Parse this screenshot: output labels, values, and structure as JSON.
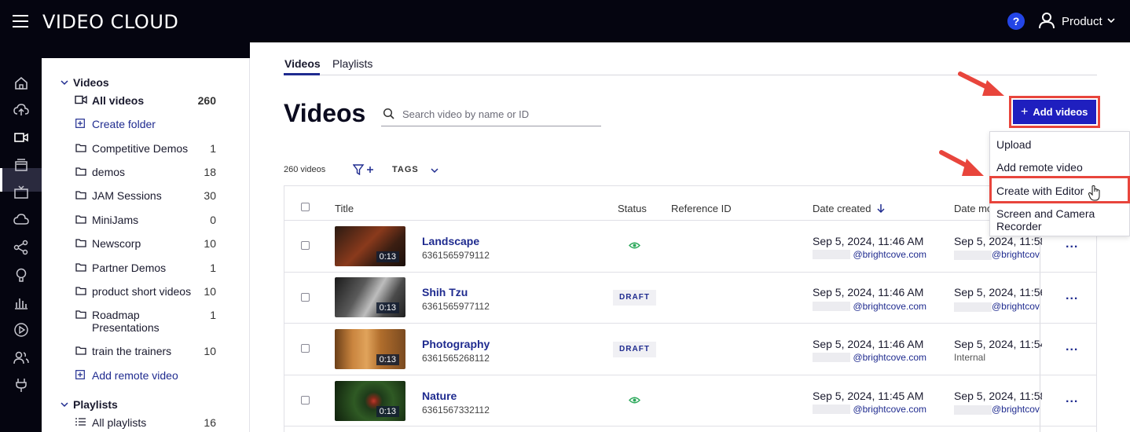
{
  "app": {
    "brand": "VIDEO CLOUD",
    "help_label": "?",
    "account_label": "Product"
  },
  "colors": {
    "accent": "#1f1fbf",
    "link": "#1f2b8f",
    "highlight": "#e8453c",
    "topbar": "#050510"
  },
  "rail": {
    "icons": [
      "home-icon",
      "upload-icon",
      "video-icon",
      "media-icon",
      "tv-icon",
      "cloud-icon",
      "share-icon",
      "lightbulb-icon",
      "analytics-icon",
      "play-icon",
      "users-icon",
      "plug-icon"
    ]
  },
  "sidebar": {
    "videos_section": "Videos",
    "all_videos": {
      "label": "All videos",
      "count": "260"
    },
    "create_folder": "Create folder",
    "folders": [
      {
        "label": "Competitive Demos",
        "count": "1"
      },
      {
        "label": "demos",
        "count": "18"
      },
      {
        "label": "JAM Sessions",
        "count": "30"
      },
      {
        "label": "MiniJams",
        "count": "0"
      },
      {
        "label": "Newscorp",
        "count": "10"
      },
      {
        "label": "Partner Demos",
        "count": "1"
      },
      {
        "label": "product short videos",
        "count": "10"
      },
      {
        "label": "Roadmap\nPresentations",
        "count": "1"
      },
      {
        "label": "train the trainers",
        "count": "10"
      }
    ],
    "add_remote_video": "Add remote video",
    "playlists_section": "Playlists",
    "all_playlists": {
      "label": "All playlists",
      "count": "16"
    }
  },
  "tabs": [
    {
      "label": "Videos"
    },
    {
      "label": "Playlists"
    }
  ],
  "page": {
    "title": "Videos",
    "search_placeholder": "Search video by name or ID",
    "add_videos_label": "Add videos",
    "video_count": "260 videos",
    "tags_label": "TAGS"
  },
  "menu": {
    "items": [
      "Upload",
      "Add remote video",
      "Create with Editor",
      "Screen and Camera\nRecorder"
    ]
  },
  "table": {
    "headers": {
      "title": "Title",
      "status": "Status",
      "reference_id": "Reference ID",
      "date_created": "Date created",
      "date_modified": "Date mo"
    },
    "rows": [
      {
        "title": "Landscape",
        "id": "6361565979112",
        "duration": "0:13",
        "status": "visible",
        "created": "Sep 5, 2024, 11:46 AM",
        "created_by": "@brightcove.com",
        "modified": "Sep 5, 2024, 11:58",
        "modified_by": "@brightcov"
      },
      {
        "title": "Shih Tzu",
        "id": "6361565977112",
        "duration": "0:13",
        "status": "DRAFT",
        "created": "Sep 5, 2024, 11:46 AM",
        "created_by": "@brightcove.com",
        "modified": "Sep 5, 2024, 11:56",
        "modified_by": "@brightcov"
      },
      {
        "title": "Photography",
        "id": "6361565268112",
        "duration": "0:13",
        "status": "DRAFT",
        "created": "Sep 5, 2024, 11:46 AM",
        "created_by": "@brightcove.com",
        "modified": "Sep 5, 2024, 11:54",
        "modified_by": "Internal"
      },
      {
        "title": "Nature",
        "id": "6361567332112",
        "duration": "0:13",
        "status": "visible",
        "created": "Sep 5, 2024, 11:45 AM",
        "created_by": "@brightcove.com",
        "modified": "Sep 5, 2024, 11:58",
        "modified_by": "@brightcov"
      }
    ],
    "more_label": "..."
  }
}
